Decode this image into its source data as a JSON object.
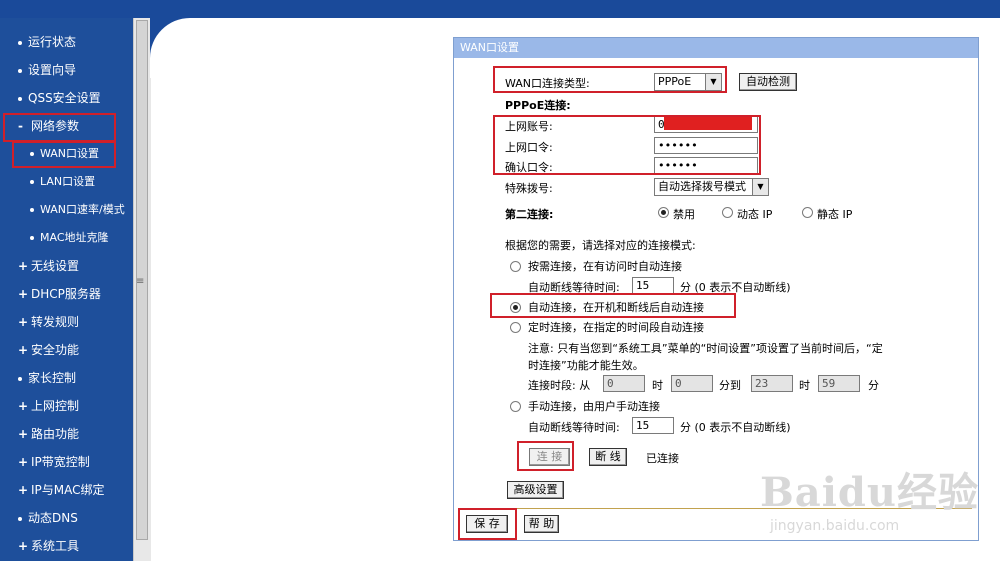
{
  "menu": {
    "items": [
      {
        "label": "运行状态",
        "kind": "top",
        "marker": "•"
      },
      {
        "label": "设置向导",
        "kind": "top",
        "marker": "•"
      },
      {
        "label": "QSS安全设置",
        "kind": "top",
        "marker": "•"
      },
      {
        "label": "网络参数",
        "kind": "top",
        "marker": "-"
      },
      {
        "label": "WAN口设置",
        "kind": "sub",
        "marker": "•"
      },
      {
        "label": "LAN口设置",
        "kind": "sub",
        "marker": "•"
      },
      {
        "label": "WAN口速率/模式",
        "kind": "sub",
        "marker": "•"
      },
      {
        "label": "MAC地址克隆",
        "kind": "sub",
        "marker": "•"
      },
      {
        "label": "无线设置",
        "kind": "top",
        "marker": "+"
      },
      {
        "label": "DHCP服务器",
        "kind": "top",
        "marker": "+"
      },
      {
        "label": "转发规则",
        "kind": "top",
        "marker": "+"
      },
      {
        "label": "安全功能",
        "kind": "top",
        "marker": "+"
      },
      {
        "label": "家长控制",
        "kind": "top",
        "marker": "•"
      },
      {
        "label": "上网控制",
        "kind": "top",
        "marker": "+"
      },
      {
        "label": "路由功能",
        "kind": "top",
        "marker": "+"
      },
      {
        "label": "IP带宽控制",
        "kind": "top",
        "marker": "+"
      },
      {
        "label": "IP与MAC绑定",
        "kind": "top",
        "marker": "+"
      },
      {
        "label": "动态DNS",
        "kind": "top",
        "marker": "•"
      },
      {
        "label": "系统工具",
        "kind": "top",
        "marker": "+"
      }
    ]
  },
  "panel": {
    "title": "WAN口设置",
    "conn_type_label": "WAN口连接类型:",
    "conn_type_value": "PPPoE",
    "auto_detect_label": "自动检测",
    "pppoe_heading": "PPPoE连接:",
    "account_label": "上网账号:",
    "account_value": "0",
    "password_label": "上网口令:",
    "password_value": "••••••",
    "confirm_label": "确认口令:",
    "confirm_value": "••••••",
    "special_dial_label": "特殊拨号:",
    "special_dial_value": "自动选择拨号模式",
    "second_conn_label": "第二连接:",
    "second_conn_options": [
      "禁用",
      "动态 IP",
      "静态 IP"
    ],
    "mode_intro": "根据您的需要，请选择对应的连接模式:",
    "mode_on_demand": "按需连接，在有访问时自动连接",
    "idle_wait_label": "自动断线等待时间:",
    "idle_wait_value": "15",
    "idle_wait_unit": "分 (0 表示不自动断线)",
    "mode_auto": "自动连接，在开机和断线后自动连接",
    "mode_timed": "定时连接，在指定的时间段自动连接",
    "note_line1": "注意: 只有当您到“系统工具”菜单的“时间设置”项设置了当前时间后，“定",
    "note_line2": "时连接”功能才能生效。",
    "period_label": "连接时段: 从",
    "period_from_h": "0",
    "period_hour": "时",
    "period_from_m": "0",
    "period_to": "分到",
    "period_to_h": "23",
    "period_hour2": "时",
    "period_to_m": "59",
    "period_min": "分",
    "mode_manual": "手动连接，由用户手动连接",
    "idle_wait2_value": "15",
    "connect_label": "连 接",
    "disconnect_label": "断 线",
    "status_text": "已连接",
    "advanced_label": "高级设置",
    "save_label": "保 存",
    "help_label": "帮 助"
  },
  "watermark": {
    "main": "Baidu经验",
    "sub": "jingyan.baidu.com"
  },
  "colors": {
    "sidebar": "#1e4f9b",
    "highlight": "#d0202a",
    "panel_header": "#9ab8e8"
  }
}
